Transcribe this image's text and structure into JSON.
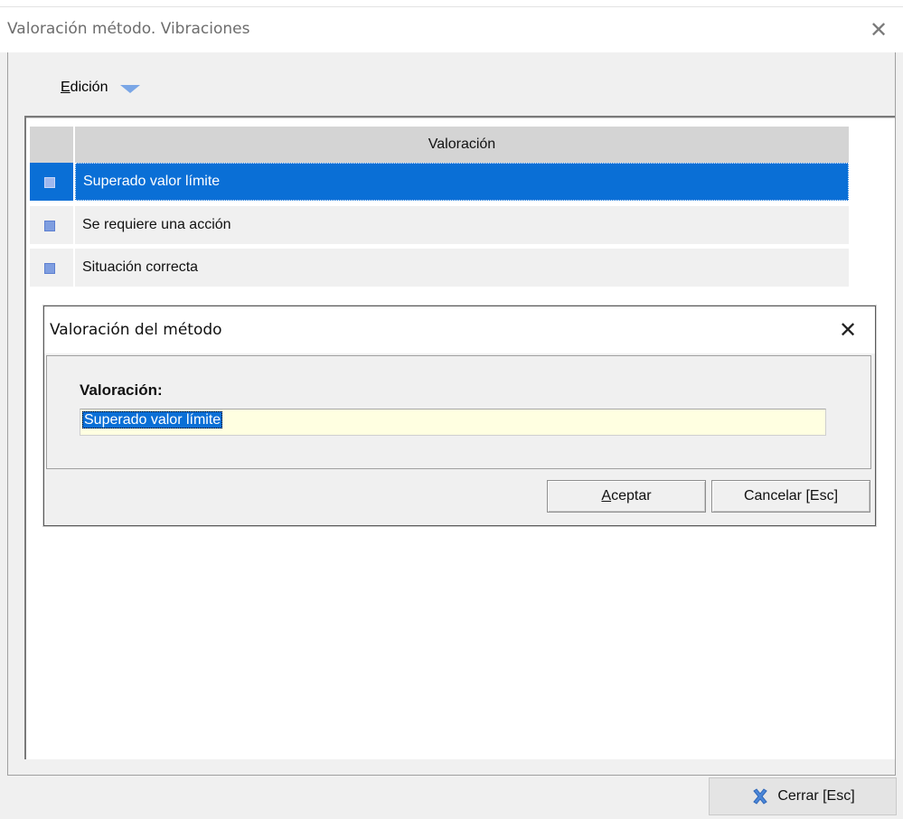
{
  "window": {
    "title": "Valoración método. Vibraciones",
    "close_glyph": "✕"
  },
  "menu": {
    "edicion_mnemonic": "E",
    "edicion_rest": "dición",
    "dropdown_icon": "triangle-down-icon"
  },
  "grid": {
    "column_header": "Valoración",
    "rows": [
      {
        "label": "Superado valor límite",
        "selected": true
      },
      {
        "label": "Se requiere una acción",
        "selected": false
      },
      {
        "label": "Situación correcta",
        "selected": false
      }
    ]
  },
  "dialog": {
    "title": "Valoración del método",
    "close_glyph": "✕",
    "field_label": "Valoración:",
    "field_value": "Superado valor límite",
    "aceptar_mnemonic": "A",
    "aceptar_rest": "ceptar",
    "cancelar_label": "Cancelar [Esc]"
  },
  "footer": {
    "cerrar_label": "Cerrar [Esc]",
    "cerrar_icon": "blue-x-icon"
  },
  "colors": {
    "selection": "#0a6fd6",
    "input_bg": "#ffffe1",
    "row_marker": "#7f9ee0"
  }
}
